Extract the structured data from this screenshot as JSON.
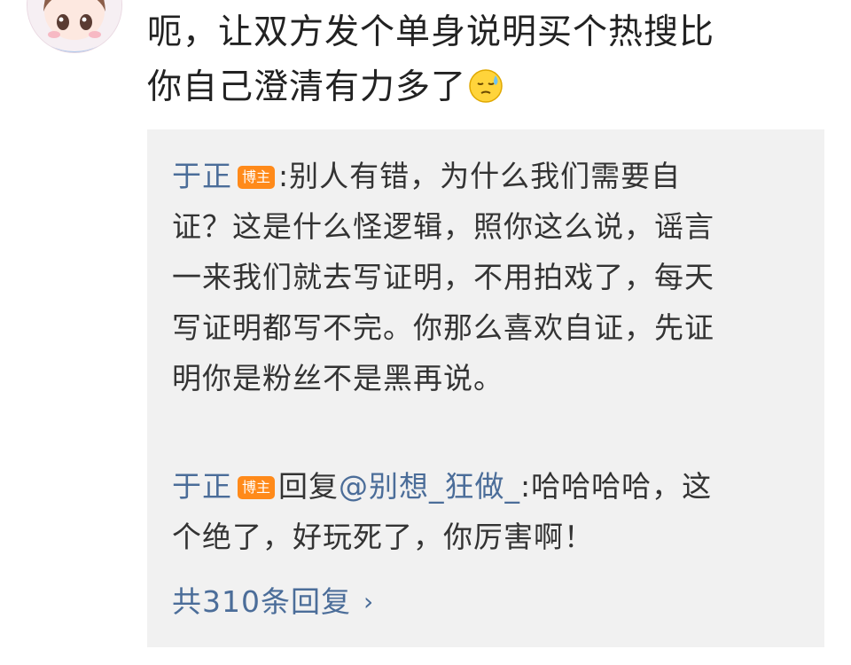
{
  "comment": {
    "text_line1": "呃，让双方发个单身说明买个热搜比",
    "text_line2": "你自己澄清有力多了",
    "emoji_icon": "sweat-face-emoji"
  },
  "replies": [
    {
      "user": "于正",
      "badge": "博主",
      "separator": ":",
      "text": "别人有错，为什么我们需要自证？这是什么怪逻辑，照你这么说，谣言一来我们就去写证明，不用拍戏了，每天写证明都写不完。你那么喜欢自证，先证明你是粉丝不是黑再说。"
    },
    {
      "user": "于正",
      "badge": "博主",
      "reply_word": "回复",
      "mention": "@别想_狂做_",
      "separator": ":",
      "text": "哈哈哈哈，这个绝了，好玩死了，你厉害啊！"
    }
  ],
  "more_replies": {
    "label": "共310条回复",
    "chevron": "›"
  },
  "colors": {
    "link": "#4b6d99",
    "badge": "#ff8a1a",
    "reply_bg": "#f1f1f1"
  }
}
